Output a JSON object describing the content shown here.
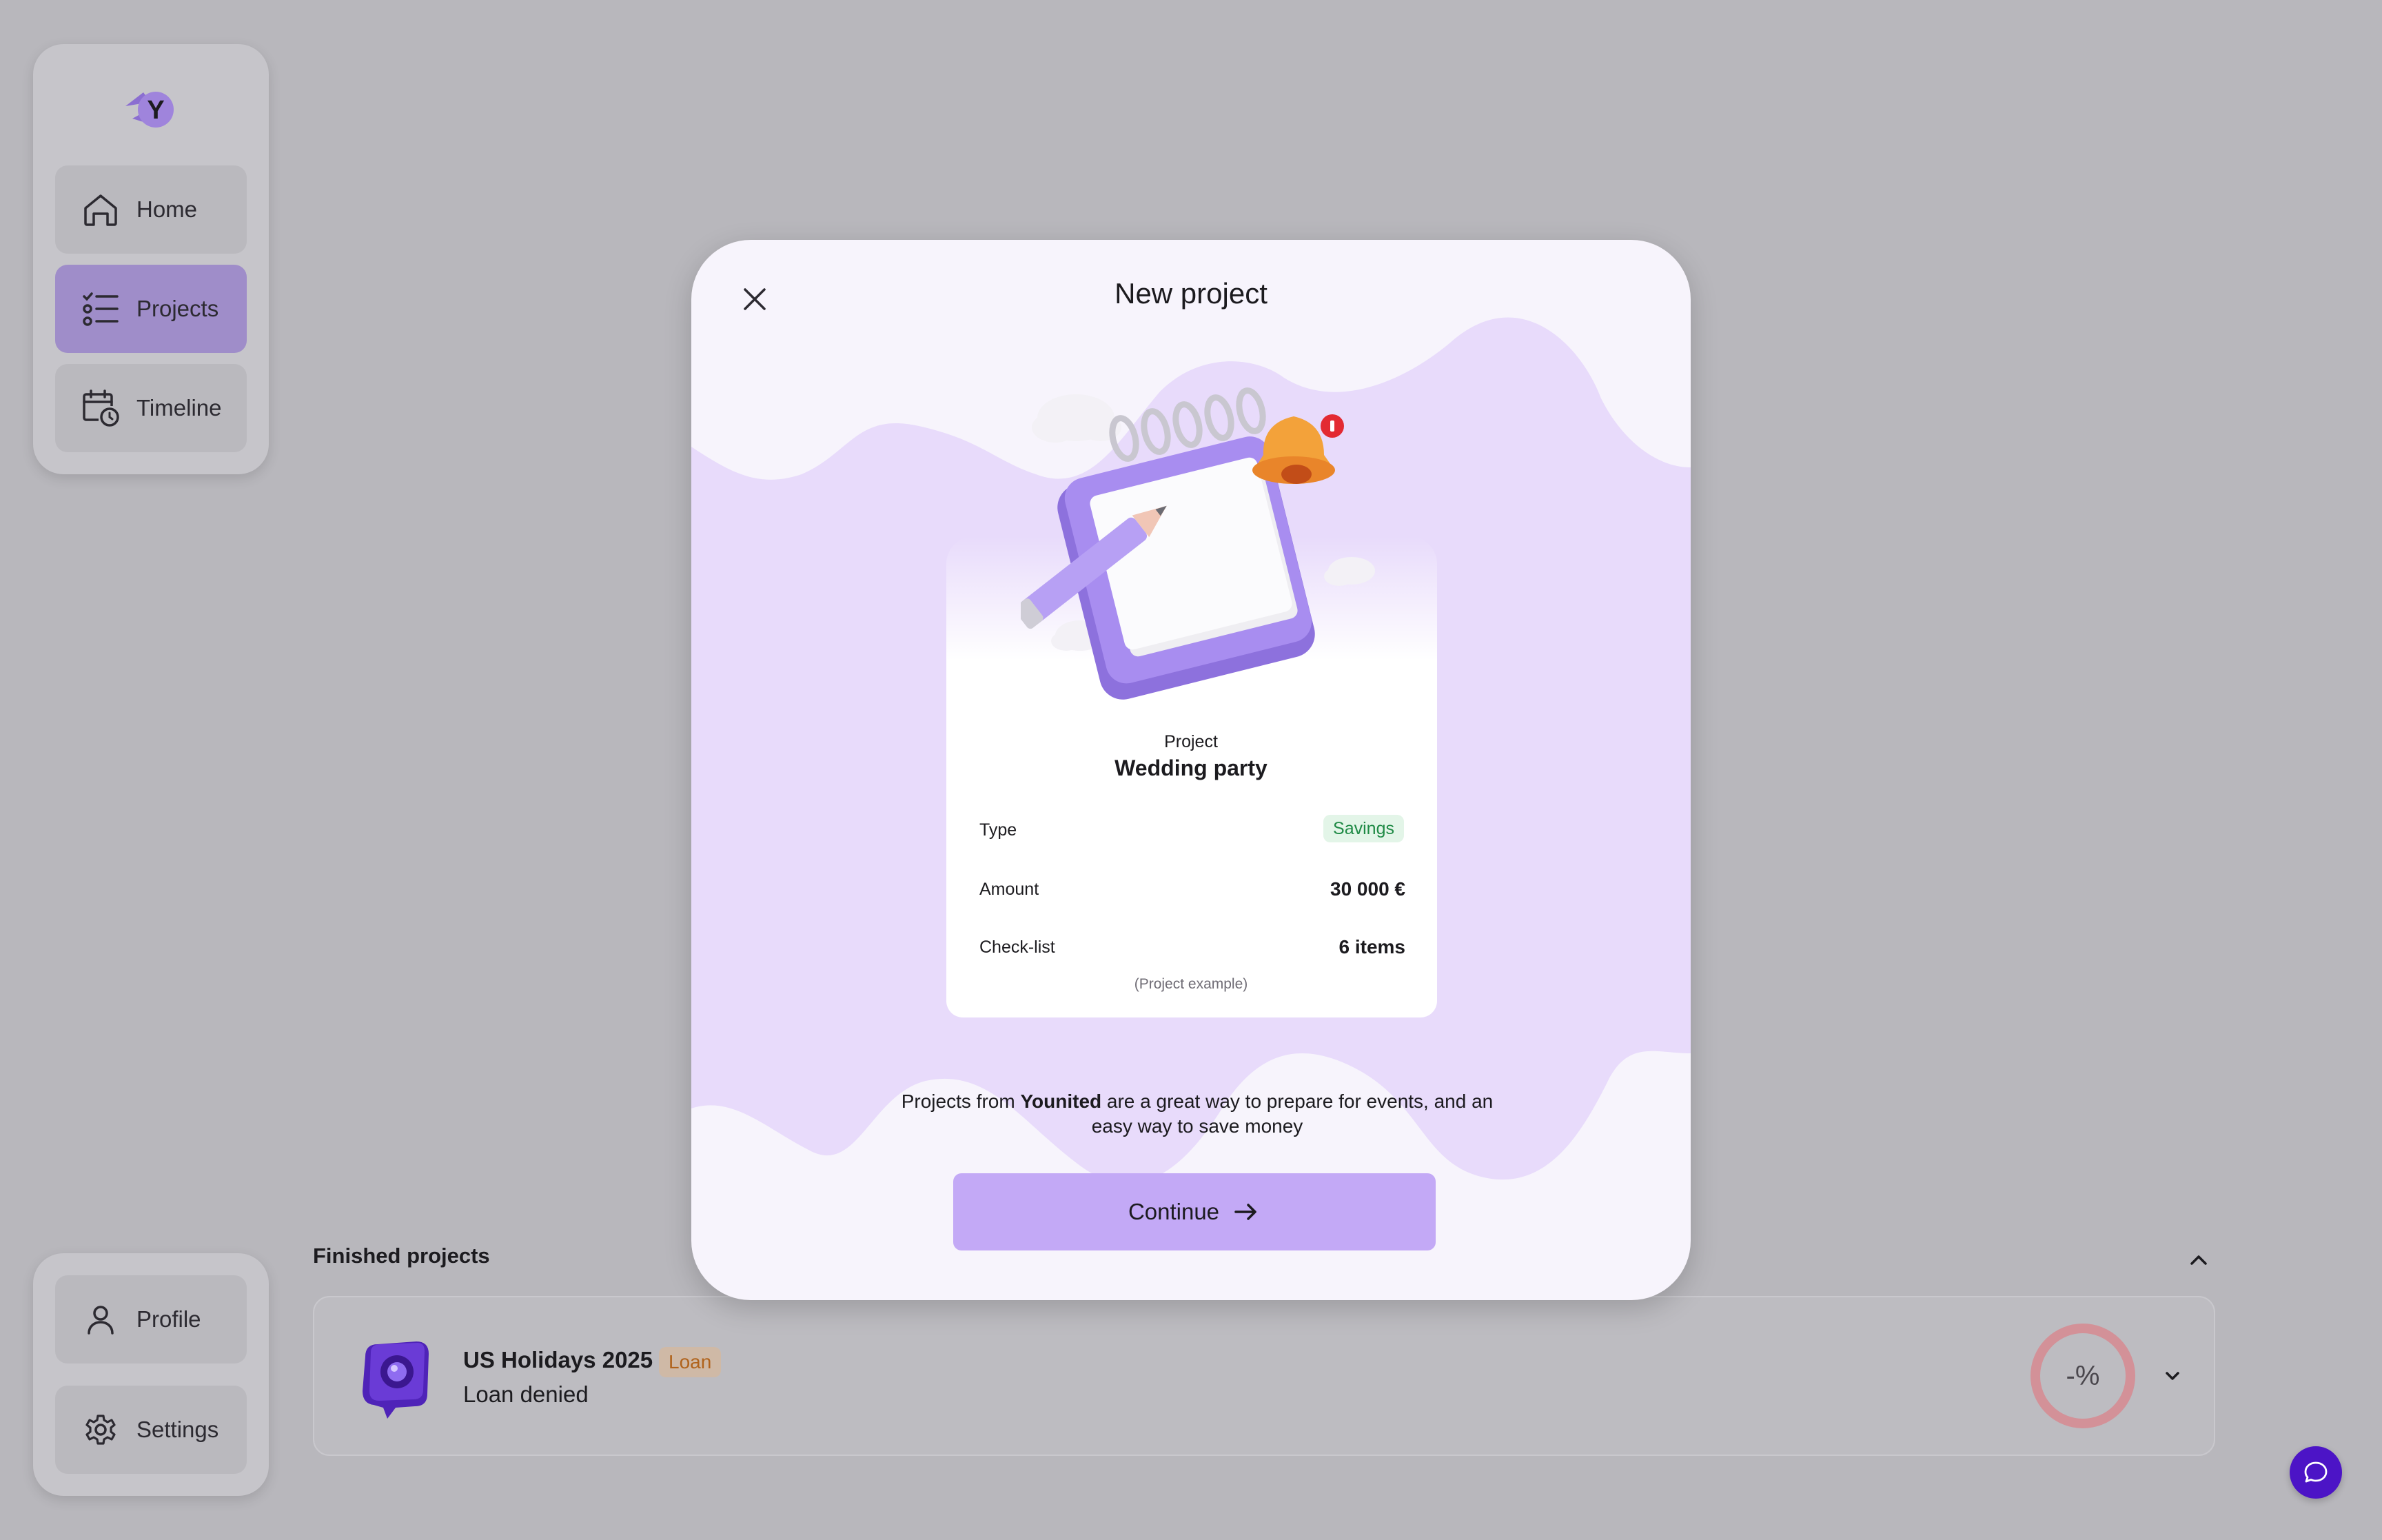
{
  "sidebar": {
    "logo_letter": "Y",
    "items": [
      {
        "label": "Home",
        "icon": "home-icon"
      },
      {
        "label": "Projects",
        "icon": "checklist-icon",
        "active": true
      },
      {
        "label": "Timeline",
        "icon": "calendar-clock-icon"
      }
    ],
    "bottom_items": [
      {
        "label": "Profile",
        "icon": "user-icon"
      },
      {
        "label": "Settings",
        "icon": "gear-icon"
      }
    ]
  },
  "background": {
    "section_title": "Finished projects",
    "project": {
      "name": "US Holidays 2025",
      "badge": "Loan",
      "status": "Loan denied",
      "rate": "-%"
    }
  },
  "modal": {
    "title": "New project",
    "example": {
      "label": "Project",
      "name": "Wedding party",
      "rows": [
        {
          "key": "Type",
          "value": "Savings"
        },
        {
          "key": "Amount",
          "value": "30 000 €"
        },
        {
          "key": "Check-list",
          "value": "6 items"
        }
      ],
      "footnote": "(Project example)"
    },
    "description": {
      "before": "Projects from ",
      "brand": "Younited",
      "after": " are a great way to prepare for events, and an easy way to save money"
    },
    "continue_label": "Continue"
  },
  "colors": {
    "accent": "#c3a9f6",
    "chat": "#4c14c6",
    "savings_green": "#1f8a45",
    "loan_orange": "#b0631c"
  }
}
